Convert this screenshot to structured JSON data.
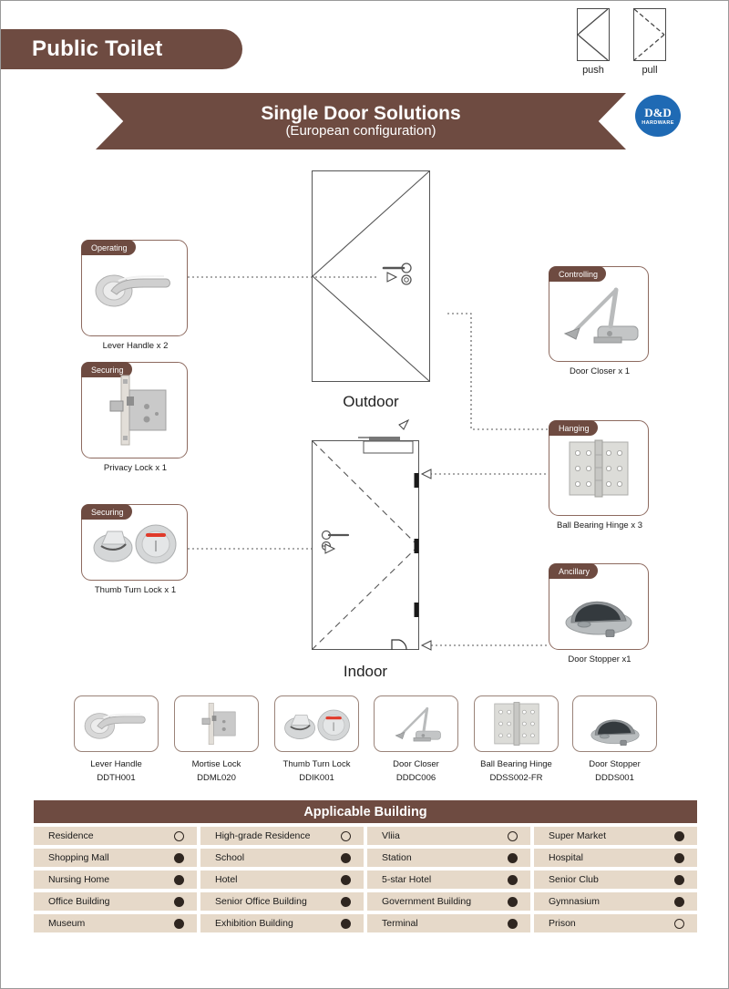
{
  "header": {
    "title": "Public Toilet",
    "banner_title": "Single Door Solutions",
    "banner_subtitle": "(European configuration)",
    "logo_main": "D&D",
    "logo_sub": "HARDWARE",
    "push_label": "push",
    "pull_label": "pull"
  },
  "diagram": {
    "outdoor_caption": "Outdoor",
    "indoor_caption": "Indoor"
  },
  "callouts": [
    {
      "tab": "Operating",
      "caption": "Lever Handle x 2",
      "icon": "lever-handle-icon"
    },
    {
      "tab": "Securing",
      "caption": "Privacy Lock x 1",
      "icon": "mortise-lock-icon"
    },
    {
      "tab": "Securing",
      "caption": "Thumb Turn Lock x 1",
      "icon": "thumb-turn-lock-icon"
    },
    {
      "tab": "Controlling",
      "caption": "Door Closer x 1",
      "icon": "door-closer-icon"
    },
    {
      "tab": "Hanging",
      "caption": "Ball Bearing Hinge x 3",
      "icon": "ball-bearing-hinge-icon"
    },
    {
      "tab": "Ancillary",
      "caption": "Door Stopper x1",
      "icon": "door-stopper-icon"
    }
  ],
  "products": [
    {
      "name": "Lever Handle",
      "code": "DDTH001",
      "icon": "lever-handle-icon"
    },
    {
      "name": "Mortise Lock",
      "code": "DDML020",
      "icon": "mortise-lock-icon"
    },
    {
      "name": "Thumb Turn Lock",
      "code": "DDIK001",
      "icon": "thumb-turn-lock-icon"
    },
    {
      "name": "Door Closer",
      "code": "DDDC006",
      "icon": "door-closer-icon"
    },
    {
      "name": "Ball Bearing Hinge",
      "code": "DDSS002-FR",
      "icon": "ball-bearing-hinge-icon"
    },
    {
      "name": "Door Stopper",
      "code": "DDDS001",
      "icon": "door-stopper-icon"
    }
  ],
  "applicable_building": {
    "title": "Applicable Building",
    "rows": [
      [
        {
          "label": "Residence",
          "state": "open"
        },
        {
          "label": "High-grade Residence",
          "state": "open"
        },
        {
          "label": "Vliia",
          "state": "open"
        },
        {
          "label": "Super Market",
          "state": "filled"
        }
      ],
      [
        {
          "label": "Shopping Mall",
          "state": "filled"
        },
        {
          "label": "School",
          "state": "filled"
        },
        {
          "label": "Station",
          "state": "filled"
        },
        {
          "label": "Hospital",
          "state": "filled"
        }
      ],
      [
        {
          "label": "Nursing Home",
          "state": "filled"
        },
        {
          "label": "Hotel",
          "state": "filled"
        },
        {
          "label": "5-star Hotel",
          "state": "filled"
        },
        {
          "label": "Senior Club",
          "state": "filled"
        }
      ],
      [
        {
          "label": "Office Building",
          "state": "filled"
        },
        {
          "label": "Senior Office Building",
          "state": "filled"
        },
        {
          "label": "Government Building",
          "state": "filled"
        },
        {
          "label": "Gymnasium",
          "state": "filled"
        }
      ],
      [
        {
          "label": "Museum",
          "state": "filled"
        },
        {
          "label": "Exhibition Building",
          "state": "filled"
        },
        {
          "label": "Terminal",
          "state": "filled"
        },
        {
          "label": "Prison",
          "state": "open"
        }
      ]
    ]
  },
  "colors": {
    "brand_brown": "#6e4b41",
    "cell_beige": "#e6d9c9",
    "logo_blue": "#1f6ab4",
    "dot_dark": "#2f2620"
  }
}
